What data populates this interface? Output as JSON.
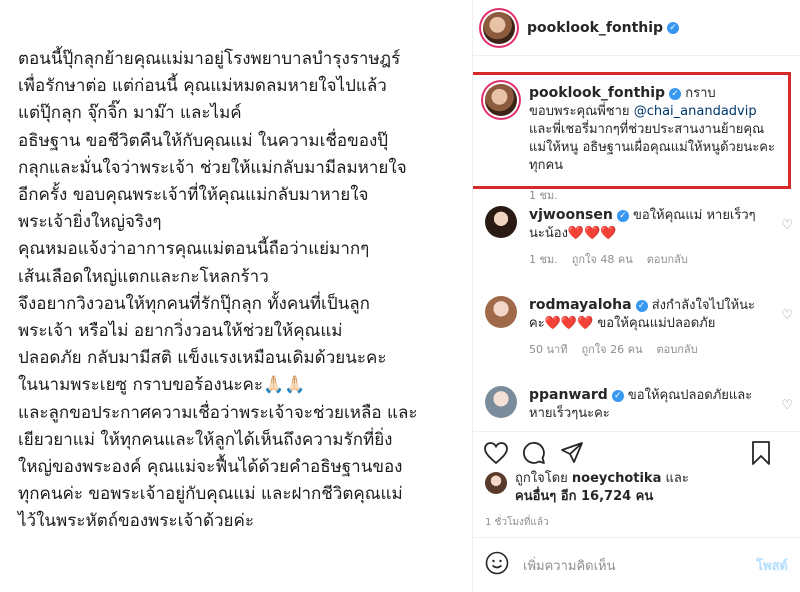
{
  "post": {
    "text": "ตอนนี้ปุ๊กลุกย้ายคุณแม่มาอยู่โรงพยาบาลบำรุงราษฎร์\nเพื่อรักษาต่อ แต่ก่อนนี้ คุณแม่หมดลมหายใจไปแล้ว\nแต่ปุ๊กลุก จุ๊กจิ๊ก มาม๊า และไมค์\nอธิษฐาน ขอชีวิตคืนให้กับคุณแม่ ในความเชื่อของปุ๊\nกลุกและมั่นใจว่าพระเจ้า ช่วยให้แม่กลับมามีลมหายใจ\nอีกครั้ง ขอบคุณพระเจ้าที่ให้คุณแม่กลับมาหายใจ\nพระเจ้ายิ่งใหญ่จริงๆ\nคุณหมอแจ้งว่าอาการคุณแม่ตอนนี้ถือว่าแย่มากๆ\nเส้นเลือดใหญ่แตกและกะโหลกร้าว\nจึงอยากวิงวอนให้ทุกคนที่รักปุ๊กลุก ทั้งคนที่เป็นลูก\nพระเจ้า หรือไม่ อยากวิ่งวอนให้ช่วยให้คุณแม่\nปลอดภัย กลับมามีสติ แข็งแรงเหมือนเดิมด้วยนะคะ\nในนามพระเยซู กราบขอร้องนะคะ🙏🏻🙏🏻\nและลูกขอประกาศความเชื่อว่าพระเจ้าจะช่วยเหลือ และ\nเยียวยาแม่ ให้ทุกคนและให้ลูกได้เห็นถึงความรักที่ยิ่ง\nใหญ่ของพระองค์ คุณแม่จะฟื้นได้ด้วยคำอธิษฐานของ\nทุกคนค่ะ ขอพระเจ้าอยู่กับคุณแม่ และฝากชีวิตคุณแม่\nไว้ในพระหัตถ์ของพระเจ้าด้วยค่ะ"
  },
  "header": {
    "username": "pooklook_fonthip"
  },
  "caption": {
    "username": "pooklook_fonthip",
    "text_before": "กราบขอบพระคุณพี่ชาย ",
    "mention": "@chai_anandadvip",
    "text_after": " และพี่เชอรี่มากๆที่ช่วยประสานงานย้ายคุณแม่ให้หนู อธิษฐานเผื่อคุณแม่ให้หนูด้วยนะคะทุกคน",
    "time": "1 ชม."
  },
  "comments": [
    {
      "username": "vjwoonsen",
      "text": "ขอให้คุณแม่ หายเร็วๆ นะน้อง❤️❤️❤️",
      "time": "1 ชม.",
      "likes": "ถูกใจ 48 คน",
      "reply": "ตอบกลับ"
    },
    {
      "username": "rodmayaloha",
      "text": "ส่งกำลังใจไปให้นะคะ❤️❤️❤️ ขอให้คุณแม่ปลอดภัย",
      "time": "50 นาที",
      "likes": "ถูกใจ 26 คน",
      "reply": "ตอบกลับ"
    },
    {
      "username": "ppanward",
      "text": "ขอให้คุณปลอดภัยและหายเร็วๆนะคะ"
    }
  ],
  "likes": {
    "prefix": "ถูกใจโดย ",
    "user": "noeychotika",
    "middle": " และ",
    "others": "คนอื่นๆ อีก 16,724 คน"
  },
  "timestamp": "1 ชั่วโมงที่แล้ว",
  "add_comment": {
    "placeholder": "เพิ่มความคิดเห็น",
    "post_label": "โพสต์"
  },
  "colors": {
    "verified": "#3897f0",
    "highlight": "#d62a2a",
    "mention": "#00376b"
  }
}
